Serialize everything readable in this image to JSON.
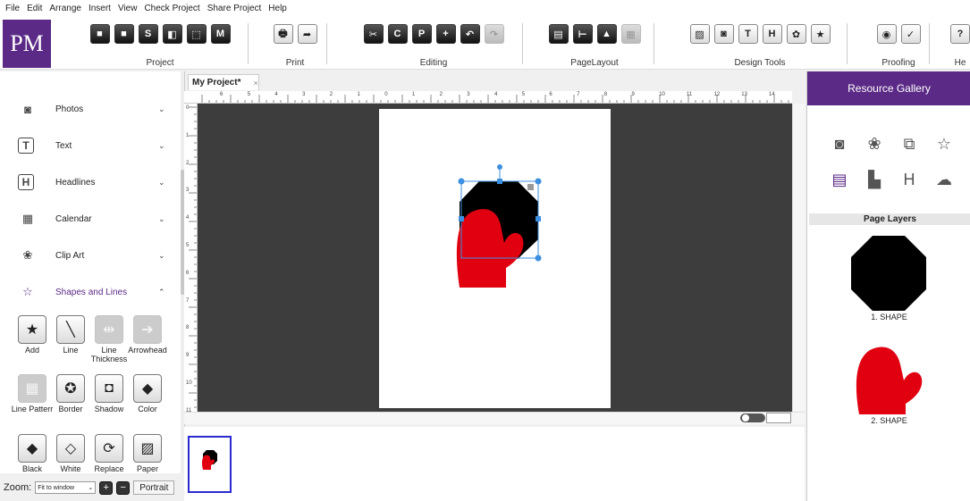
{
  "menu": [
    "File",
    "Edit",
    "Arrange",
    "Insert",
    "View",
    "Check Project",
    "Share Project",
    "Help"
  ],
  "logo": "PM",
  "ribbon": {
    "groups": [
      {
        "label": "Project",
        "icons": [
          "new-doc-icon",
          "folder-icon",
          "save-icon",
          "save-as-icon",
          "export-icon",
          "template-icon"
        ],
        "glyphs": [
          "■",
          "■",
          "S",
          "◧",
          "⬚",
          "M"
        ]
      },
      {
        "label": "Print",
        "icons": [
          "printer-icon",
          "share-icon"
        ],
        "glyphs": [
          "🖶",
          "➦"
        ]
      },
      {
        "label": "Editing",
        "icons": [
          "cut-icon",
          "copy-icon",
          "paste-icon",
          "paste-special-icon",
          "undo-icon",
          "redo-icon"
        ],
        "glyphs": [
          "✂",
          "C",
          "P",
          "+",
          "↶",
          "↷"
        ]
      },
      {
        "label": "PageLayout",
        "icons": [
          "layers-icon",
          "guides-icon",
          "align-icon",
          "background-icon"
        ],
        "glyphs": [
          "▤",
          "⊢",
          "▲",
          "▦"
        ]
      },
      {
        "label": "Design Tools",
        "icons": [
          "image-icon",
          "camera-icon",
          "text-tool-icon",
          "headline-icon",
          "clipart-icon",
          "shape-icon"
        ],
        "glyphs": [
          "▨",
          "◙",
          "T",
          "H",
          "✿",
          "★"
        ]
      },
      {
        "label": "Proofing",
        "icons": [
          "preview-icon",
          "spellcheck-icon"
        ],
        "glyphs": [
          "◉",
          "✓"
        ]
      },
      {
        "label": "He",
        "icons": [
          "help-icon"
        ],
        "glyphs": [
          "?"
        ]
      }
    ]
  },
  "left_panel": {
    "items": [
      {
        "label": "Photos",
        "glyph": "◙"
      },
      {
        "label": "Text",
        "glyph": "T"
      },
      {
        "label": "Headlines",
        "glyph": "H"
      },
      {
        "label": "Calendar",
        "glyph": "▦"
      },
      {
        "label": "Clip Art",
        "glyph": "❀"
      },
      {
        "label": "Shapes and Lines",
        "glyph": "☆"
      }
    ],
    "tools": [
      {
        "label": "Add",
        "glyph": "★"
      },
      {
        "label": "Line",
        "glyph": "╲"
      },
      {
        "label": "Line Thickness",
        "glyph": "⇹"
      },
      {
        "label": "Arrowhead",
        "glyph": "➔"
      },
      {
        "label": "Line Patterr",
        "glyph": "▦"
      },
      {
        "label": "Border",
        "glyph": "✪"
      },
      {
        "label": "Shadow",
        "glyph": "◘"
      },
      {
        "label": "Color",
        "glyph": "◆"
      },
      {
        "label": "Black",
        "glyph": "◆"
      },
      {
        "label": "White",
        "glyph": "◇"
      },
      {
        "label": "Replace",
        "glyph": "⟳"
      },
      {
        "label": "Paper",
        "glyph": "▨"
      }
    ]
  },
  "zoom": {
    "label": "Zoom:",
    "value": "Fit to window",
    "zoom_in": "+",
    "zoom_out": "−",
    "orientation": "Portrait"
  },
  "document": {
    "tab": "My Project*",
    "close": "×"
  },
  "ruler": {
    "h": [
      "6",
      "5",
      "4",
      "3",
      "2",
      "1",
      "0",
      "1",
      "2",
      "3",
      "4",
      "5",
      "6",
      "7",
      "8",
      "9",
      "10",
      "11",
      "12",
      "13",
      "14",
      "15"
    ],
    "v": [
      "0",
      "1",
      "2",
      "3",
      "4",
      "5",
      "6",
      "7",
      "8",
      "9",
      "10",
      "11"
    ]
  },
  "right_panel": {
    "title": "Resource Gallery",
    "gallery": [
      {
        "name": "photo-gallery-icon",
        "glyph": "◙"
      },
      {
        "name": "clipart-gallery-icon",
        "glyph": "❀"
      },
      {
        "name": "shapes-gallery-icon",
        "glyph": "⧉"
      },
      {
        "name": "star-gallery-icon",
        "glyph": "☆"
      },
      {
        "name": "layouts-gallery-icon",
        "glyph": "▤"
      },
      {
        "name": "templates-gallery-icon",
        "glyph": "▙"
      },
      {
        "name": "headline-gallery-icon",
        "glyph": "H"
      },
      {
        "name": "online-gallery-icon",
        "glyph": "☁"
      }
    ],
    "layers_title": "Page Layers",
    "layers": [
      "1. SHAPE",
      "2. SHAPE"
    ]
  },
  "colors": {
    "brand": "#5b2a86",
    "mitten": "#e00010",
    "shape": "#000000",
    "handle": "#3c8fe0"
  }
}
